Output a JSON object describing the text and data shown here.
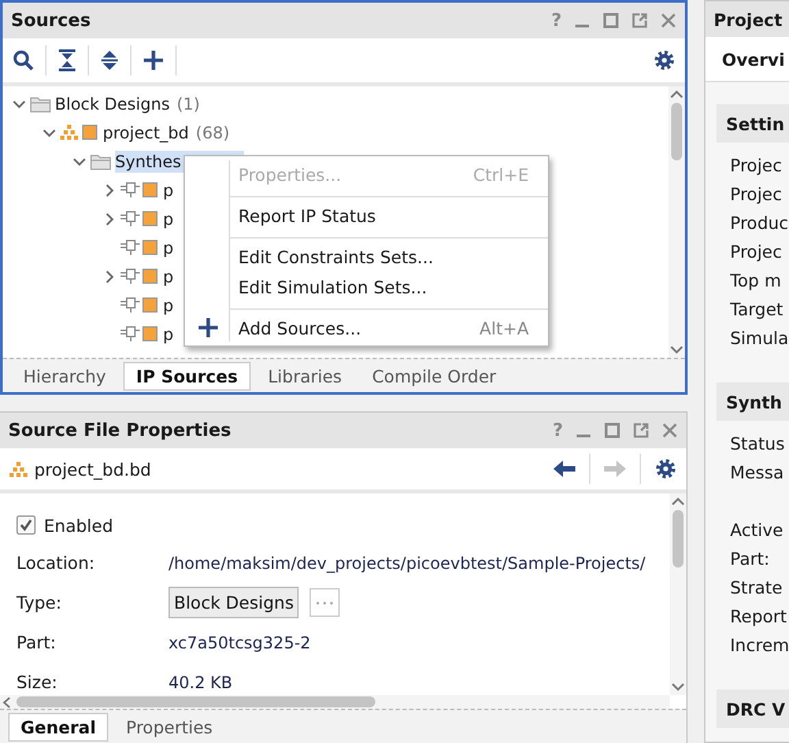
{
  "sources": {
    "title": "Sources",
    "help": "?",
    "focused": true,
    "tree": [
      {
        "label": "Block Designs",
        "count": "(1)",
        "kind": "folder",
        "expandable": true,
        "expanded": true,
        "selected": false,
        "children": [
          {
            "label": "project_bd",
            "count": "(68)",
            "kind": "design",
            "expandable": true,
            "expanded": true,
            "selected": false,
            "children": [
              {
                "label": "Synthes",
                "kind": "folder",
                "expandable": true,
                "expanded": true,
                "selected": true,
                "children": [
                  {
                    "label": "p",
                    "kind": "ip",
                    "expandable": true,
                    "expanded": false,
                    "selected": false
                  },
                  {
                    "label": "p",
                    "kind": "ip",
                    "expandable": true,
                    "expanded": false,
                    "selected": false
                  },
                  {
                    "label": "p",
                    "kind": "ip",
                    "expandable": false,
                    "selected": false
                  },
                  {
                    "label": "p",
                    "kind": "ip",
                    "expandable": true,
                    "expanded": false,
                    "selected": false
                  },
                  {
                    "label": "p",
                    "kind": "ip",
                    "expandable": false,
                    "selected": false
                  },
                  {
                    "label": "p",
                    "kind": "ip",
                    "expandable": false,
                    "selected": false
                  }
                ]
              }
            ]
          }
        ]
      }
    ],
    "tabs": [
      {
        "label": "Hierarchy",
        "selected": false
      },
      {
        "label": "IP Sources",
        "selected": true
      },
      {
        "label": "Libraries",
        "selected": false
      },
      {
        "label": "Compile Order",
        "selected": false
      }
    ]
  },
  "context_menu": {
    "items": [
      {
        "label": "Properties...",
        "shortcut": "Ctrl+E",
        "disabled": true,
        "kind": "plain",
        "separator_after": true
      },
      {
        "label": "Report IP Status",
        "disabled": false,
        "kind": "plain",
        "separator_after": true
      },
      {
        "label": "Edit Constraints Sets...",
        "disabled": false,
        "kind": "plain",
        "separator_after": false
      },
      {
        "label": "Edit Simulation Sets...",
        "disabled": false,
        "kind": "plain",
        "separator_after": true
      },
      {
        "label": "Add Sources...",
        "shortcut": "Alt+A",
        "disabled": false,
        "kind": "add"
      }
    ]
  },
  "properties": {
    "title": "Source File Properties",
    "help": "?",
    "file": "project_bd.bd",
    "enabled": {
      "label": "Enabled",
      "checked": true
    },
    "fields": [
      {
        "label": "Location:",
        "value": "/home/maksim/dev_projects/picoevbtest/Sample-Projects/",
        "kind": "text"
      },
      {
        "label": "Type:",
        "value": "Block Designs",
        "kind": "button"
      },
      {
        "label": "Part:",
        "value": "xc7a50tcsg325-2",
        "kind": "text"
      },
      {
        "label": "Size:",
        "value": "40.2 KB",
        "kind": "text"
      }
    ],
    "tabs": [
      {
        "label": "General",
        "selected": true
      },
      {
        "label": "Properties",
        "selected": false
      }
    ]
  },
  "project_panel": {
    "title": "Project",
    "tab": "Overvi",
    "sections": [
      {
        "title": "Settin",
        "rows": [
          "Projec",
          "Projec",
          "Produc",
          "Projec",
          "Top m",
          "Target",
          "Simula"
        ]
      },
      {
        "title": "Synth",
        "rows": [
          "Status",
          "Messa",
          "",
          "Active",
          "Part:",
          "Strate",
          "Report",
          "Increm"
        ]
      },
      {
        "title": "DRC V"
      }
    ]
  }
}
